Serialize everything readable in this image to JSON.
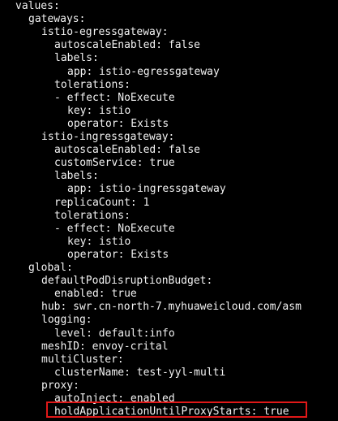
{
  "terminal": {
    "lines": [
      {
        "indent": 0,
        "text": "values:"
      },
      {
        "indent": 1,
        "text": "gateways:"
      },
      {
        "indent": 2,
        "text": "istio-egressgateway:"
      },
      {
        "indent": 3,
        "text": "autoscaleEnabled: false"
      },
      {
        "indent": 3,
        "text": "labels:"
      },
      {
        "indent": 4,
        "text": "app: istio-egressgateway"
      },
      {
        "indent": 3,
        "text": "tolerations:"
      },
      {
        "indent": 3,
        "text": "- effect: NoExecute"
      },
      {
        "indent": 4,
        "text": "key: istio"
      },
      {
        "indent": 4,
        "text": "operator: Exists"
      },
      {
        "indent": 2,
        "text": "istio-ingressgateway:"
      },
      {
        "indent": 3,
        "text": "autoscaleEnabled: false"
      },
      {
        "indent": 3,
        "text": "customService: true"
      },
      {
        "indent": 3,
        "text": "labels:"
      },
      {
        "indent": 4,
        "text": "app: istio-ingressgateway"
      },
      {
        "indent": 3,
        "text": "replicaCount: 1"
      },
      {
        "indent": 3,
        "text": "tolerations:"
      },
      {
        "indent": 3,
        "text": "- effect: NoExecute"
      },
      {
        "indent": 4,
        "text": "key: istio"
      },
      {
        "indent": 4,
        "text": "operator: Exists"
      },
      {
        "indent": 1,
        "text": "global:"
      },
      {
        "indent": 2,
        "text": "defaultPodDisruptionBudget:"
      },
      {
        "indent": 3,
        "text": "enabled: true"
      },
      {
        "indent": 2,
        "text": "hub: swr.cn-north-7.myhuaweicloud.com/asm"
      },
      {
        "indent": 2,
        "text": "logging:"
      },
      {
        "indent": 3,
        "text": "level: default:info"
      },
      {
        "indent": 2,
        "text": "meshID: envoy-crital"
      },
      {
        "indent": 2,
        "text": "multiCluster:"
      },
      {
        "indent": 3,
        "text": "clusterName: test-yyl-multi"
      },
      {
        "indent": 2,
        "text": "proxy:"
      },
      {
        "indent": 3,
        "text": "autoInject: enabled"
      },
      {
        "indent": 3,
        "text": "holdApplicationUntilProxyStarts: true",
        "highlighted": true
      }
    ]
  },
  "colors": {
    "background": "#000000",
    "text": "#f2f2f2",
    "highlight_border": "#e01818"
  }
}
